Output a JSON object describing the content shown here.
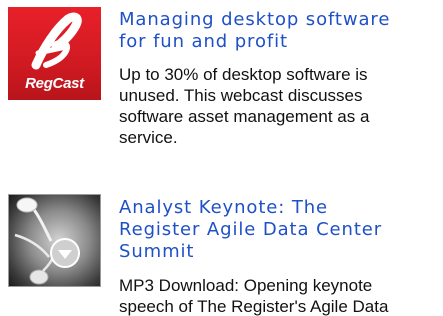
{
  "items": [
    {
      "thumb_icon": "regcast-logo-icon",
      "thumb_text": "RegCast",
      "title": "Managing desktop software\nfor fun and profit",
      "description": "Up to 30% of desktop software is\nunused. This webcast discusses\nsoftware asset management as a\nservice."
    },
    {
      "thumb_icon": "earphones-download-icon",
      "title": "Analyst Keynote: The\nRegister Agile Data Center\nSummit",
      "description": "MP3 Download: Opening keynote\nspeech of The Register's Agile Data"
    }
  ],
  "colors": {
    "title_link": "#1e50c8",
    "body_text": "#111111",
    "regcast_red": "#e8202a"
  }
}
